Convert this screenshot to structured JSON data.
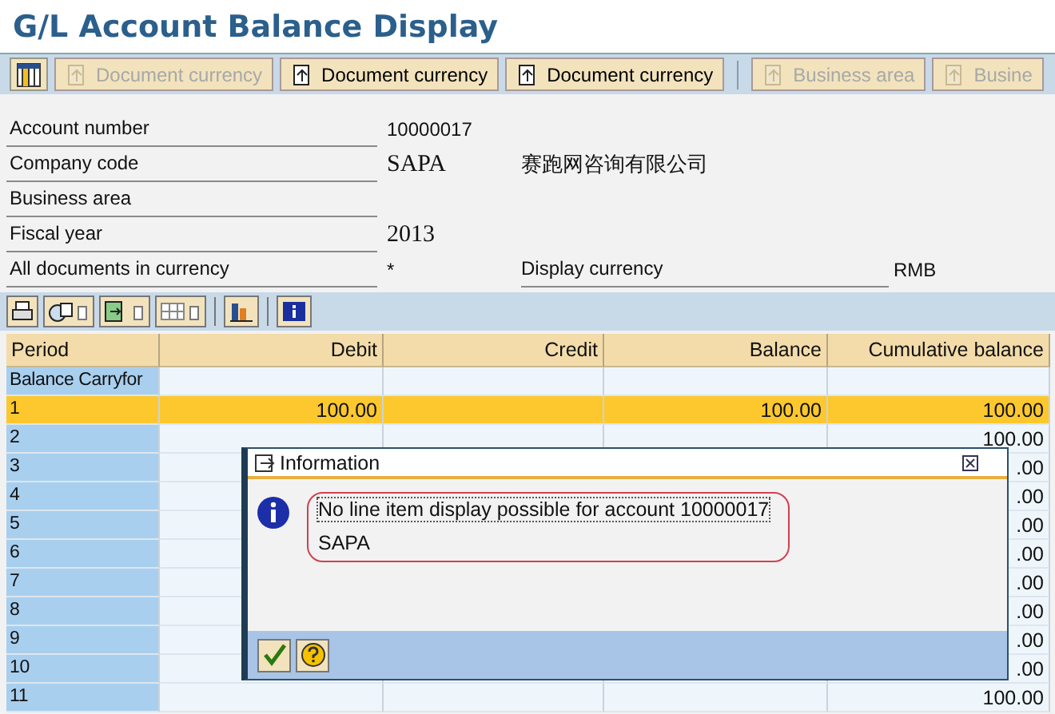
{
  "title": "G/L Account Balance Display",
  "toolbar": [
    {
      "kind": "layout"
    },
    {
      "kind": "button",
      "label": "Document currency",
      "disabled": true
    },
    {
      "kind": "button",
      "label": "Document currency",
      "disabled": false
    },
    {
      "kind": "button",
      "label": "Document currency",
      "disabled": false
    },
    {
      "kind": "separator"
    },
    {
      "kind": "button",
      "label": "Business area",
      "disabled": true
    },
    {
      "kind": "button",
      "label": "Busine",
      "disabled": true
    }
  ],
  "form": [
    {
      "label": "Account number",
      "value": "10000017",
      "kind": "text"
    },
    {
      "label": "Company code",
      "value": "SAPA",
      "kind": "field",
      "description": "赛跑网咨询有限公司"
    },
    {
      "label": "Business area",
      "kind": "text"
    },
    {
      "label": "Fiscal year",
      "value": "2013",
      "kind": "field"
    },
    {
      "label": "All documents in currency",
      "value": "*",
      "kind": "text",
      "label_2": "Display currency",
      "value_2": "RMB"
    }
  ],
  "table": {
    "columns": [
      "Period",
      "Debit",
      "Credit",
      "Balance",
      "Cumulative balance"
    ],
    "rows": [
      {
        "cells": [
          "Balance Carryfor",
          "",
          "",
          "",
          ""
        ],
        "selected": false
      },
      {
        "cells": [
          "1",
          "100.00",
          "",
          "100.00",
          "100.00"
        ],
        "selected": true
      },
      {
        "cells": [
          "2",
          "",
          "",
          "",
          "100.00"
        ],
        "selected": false
      },
      {
        "cells": [
          "3",
          "",
          "",
          "",
          ".00"
        ],
        "selected": false
      },
      {
        "cells": [
          "4",
          "",
          "",
          "",
          ".00"
        ],
        "selected": false
      },
      {
        "cells": [
          "5",
          "",
          "",
          "",
          ".00"
        ],
        "selected": false
      },
      {
        "cells": [
          "6",
          "",
          "",
          "",
          ".00"
        ],
        "selected": false
      },
      {
        "cells": [
          "7",
          "",
          "",
          "",
          ".00"
        ],
        "selected": false
      },
      {
        "cells": [
          "8",
          "",
          "",
          "",
          ".00"
        ],
        "selected": false
      },
      {
        "cells": [
          "9",
          "",
          "",
          "",
          ".00"
        ],
        "selected": false
      },
      {
        "cells": [
          "10",
          "",
          "",
          "",
          ".00"
        ],
        "selected": false
      },
      {
        "cells": [
          "11",
          "",
          "",
          "",
          "100.00"
        ],
        "selected": false
      }
    ]
  },
  "dialog": {
    "title": "Information",
    "lines": [
      "No line item display possible for account 10000017",
      "SAPA"
    ]
  }
}
